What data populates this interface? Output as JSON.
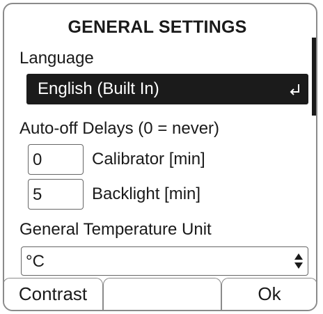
{
  "header": {
    "title": "GENERAL SETTINGS"
  },
  "language": {
    "label": "Language",
    "selected": "English (Built In)",
    "icon": "enter-icon"
  },
  "auto_off": {
    "label": "Auto-off Delays (0 = never)",
    "fields": [
      {
        "value": "0",
        "label": "Calibrator [min]"
      },
      {
        "value": "5",
        "label": "Backlight [min]"
      }
    ]
  },
  "temperature": {
    "label": "General Temperature Unit",
    "selected": "°C",
    "icon": "up-down-arrows-icon"
  },
  "softkeys": {
    "left": "Contrast",
    "middle": "",
    "right": "Ok"
  }
}
